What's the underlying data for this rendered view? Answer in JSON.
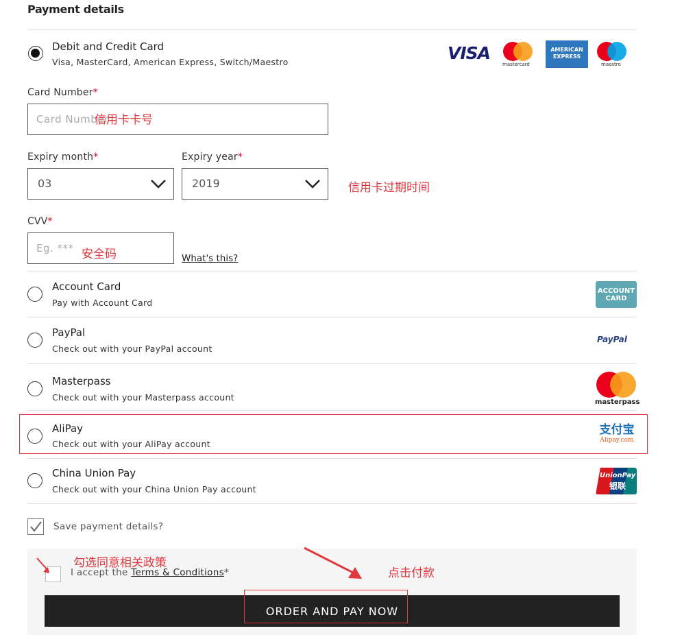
{
  "page_title": "Payment details",
  "card_option": {
    "title": "Debit and Credit Card",
    "subtitle": "Visa, MasterCard, American Express, Switch/Maestro",
    "brands": [
      "VISA",
      "mastercard",
      "AMERICAN EXPRESS",
      "maestro"
    ]
  },
  "card_number": {
    "label": "Card Number",
    "required": "*",
    "placeholder": "Card Number"
  },
  "expiry_month": {
    "label": "Expiry month",
    "required": "*",
    "value": "03"
  },
  "expiry_year": {
    "label": "Expiry year",
    "required": "*",
    "value": "2019"
  },
  "cvv": {
    "label": "CVV",
    "required": "*",
    "placeholder": "Eg. ***",
    "help_link": "What's this?"
  },
  "options": [
    {
      "title": "Account Card",
      "subtitle": "Pay with Account Card",
      "logo": "ACCOUNT CARD"
    },
    {
      "title": "PayPal",
      "subtitle": "Check out with your PayPal account",
      "logo": "PayPal"
    },
    {
      "title": "Masterpass",
      "subtitle": "Check out with your Masterpass account",
      "logo": "masterpass"
    },
    {
      "title": "AliPay",
      "subtitle": "Check out with your AliPay account",
      "logo": "支付宝",
      "logo_sub": "Alipay.com"
    },
    {
      "title": "China Union Pay",
      "subtitle": "Check out with your China Union Pay account",
      "logo": "UnionPay",
      "logo_cn": "银联"
    }
  ],
  "save_details": {
    "label": "Save payment details?",
    "checked": true
  },
  "terms": {
    "prefix": "I accept the ",
    "link": "Terms & Conditions",
    "required": "*"
  },
  "order_button": "ORDER AND PAY NOW",
  "annotations": {
    "card_number": "信用卡卡号",
    "expiry": "信用卡过期时间",
    "cvv": "安全码",
    "terms": "勾选同意相关政策",
    "pay": "点击付款"
  },
  "colors": {
    "annotation": "#e0383e",
    "button_bg": "#222222",
    "required": "#d0021b"
  }
}
